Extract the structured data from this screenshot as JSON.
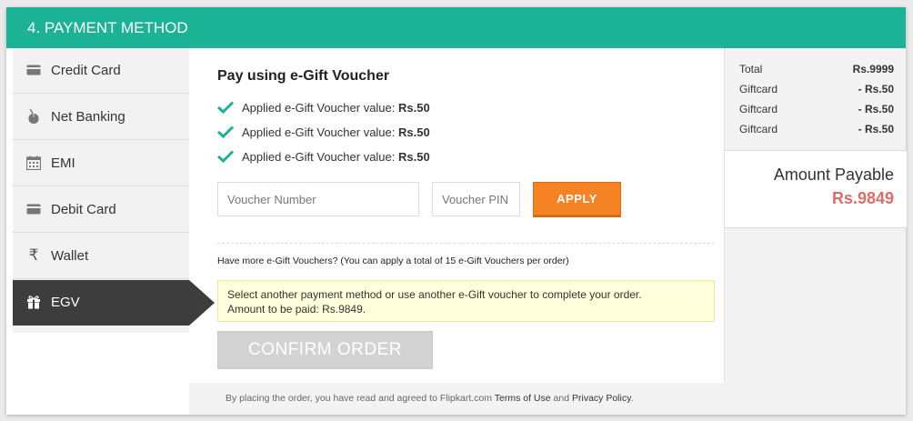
{
  "header": {
    "title": "4. PAYMENT METHOD"
  },
  "sidebar": {
    "items": [
      {
        "label": "Credit Card",
        "icon": "credit-card-icon"
      },
      {
        "label": "Net Banking",
        "icon": "mouse-icon"
      },
      {
        "label": "EMI",
        "icon": "calendar-icon"
      },
      {
        "label": "Debit Card",
        "icon": "debit-card-icon"
      },
      {
        "label": "Wallet",
        "icon": "rupee-icon"
      },
      {
        "label": "EGV",
        "icon": "gift-icon",
        "active": true
      }
    ]
  },
  "main": {
    "title": "Pay using e-Gift Voucher",
    "applied": [
      {
        "text": "Applied e-Gift Voucher value:",
        "value": "Rs.50"
      },
      {
        "text": "Applied e-Gift Voucher value:",
        "value": "Rs.50"
      },
      {
        "text": "Applied e-Gift Voucher value:",
        "value": "Rs.50"
      }
    ],
    "voucher_number_placeholder": "Voucher Number",
    "voucher_pin_placeholder": "Voucher PIN",
    "apply_label": "APPLY",
    "more_text": "Have more e-Gift Vouchers? (You can apply a total of 15 e-Gift Vouchers per order)",
    "notice_line1": "Select another payment method or use another e-Gift voucher to complete your order.",
    "notice_line2": "Amount to be paid: Rs.9849.",
    "confirm_label": "CONFIRM ORDER"
  },
  "footer": {
    "prefix": "By placing the order, you have read and agreed to Flipkart.com",
    "terms": "Terms of Use",
    "and": "and",
    "privacy": "Privacy Policy",
    "suffix": "."
  },
  "summary": {
    "rows": [
      {
        "label": "Total",
        "value": "Rs.9999"
      },
      {
        "label": "Giftcard",
        "value": "- Rs.50"
      },
      {
        "label": "Giftcard",
        "value": "- Rs.50"
      },
      {
        "label": "Giftcard",
        "value": "- Rs.50"
      }
    ],
    "payable_label": "Amount Payable",
    "payable_value": "Rs.9849"
  },
  "colors": {
    "header": "#1bb295",
    "apply_button": "#f58223",
    "sidebar_active": "#3d3d3d",
    "amount": "#dd6d67",
    "check": "#1bb295"
  }
}
